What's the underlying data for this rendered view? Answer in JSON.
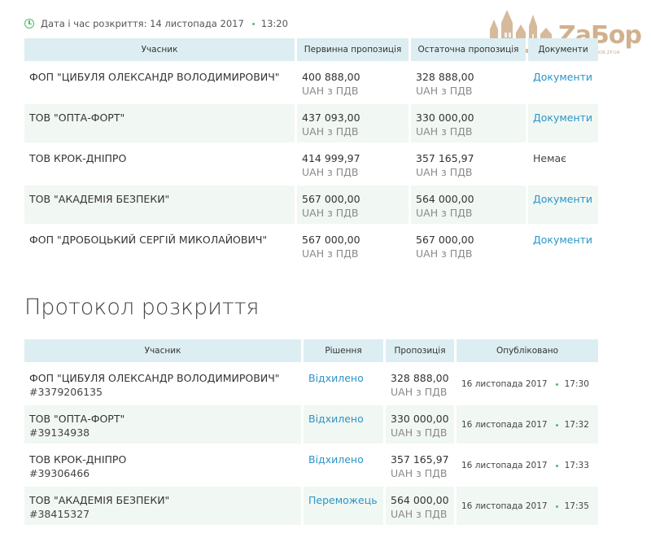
{
  "opening": {
    "label": "Дата і час розкриття: 14 листопада 2017",
    "time": "13:20"
  },
  "watermark": {
    "brand": "ZaБор",
    "url": "WWW.ZABOR.ZP.UA"
  },
  "bids_table": {
    "headers": [
      "Учасник",
      "Первинна пропозиція",
      "Остаточна пропозиція",
      "Документи"
    ],
    "rows": [
      {
        "participant": "ФОП \"ЦИБУЛЯ ОЛЕКСАНДР ВОЛОДИМИРОВИЧ\"",
        "initial": "400 888,00",
        "initial_vat": "UAH з ПДВ",
        "final": "328 888,00",
        "final_vat": "UAH з ПДВ",
        "docs": "Документи"
      },
      {
        "participant": "ТОВ \"ОПТА-ФОРТ\"",
        "initial": "437 093,00",
        "initial_vat": "UAH з ПДВ",
        "final": "330 000,00",
        "final_vat": "UAH з ПДВ",
        "docs": "Документи"
      },
      {
        "participant": "ТОВ КРОК-ДНІПРО",
        "initial": "414 999,97",
        "initial_vat": "UAH з ПДВ",
        "final": "357 165,97",
        "final_vat": "UAH з ПДВ",
        "docs": "Немає"
      },
      {
        "participant": "ТОВ \"АКАДЕМІЯ БЕЗПЕКИ\"",
        "initial": "567 000,00",
        "initial_vat": "UAH з ПДВ",
        "final": "564 000,00",
        "final_vat": "UAH з ПДВ",
        "docs": "Документи"
      },
      {
        "participant": "ФОП \"ДРОБОЦЬКИЙ СЕРГІЙ МИКОЛАЙОВИЧ\"",
        "initial": "567 000,00",
        "initial_vat": "UAH з ПДВ",
        "final": "567 000,00",
        "final_vat": "UAH з ПДВ",
        "docs": "Документи"
      }
    ]
  },
  "protocol": {
    "title": "Протокол розкриття",
    "headers": [
      "Учасник",
      "Рішення",
      "Пропозиція",
      "Опубліковано"
    ],
    "rows": [
      {
        "participant": "ФОП \"ЦИБУЛЯ ОЛЕКСАНДР ВОЛОДИМИРОВИЧ\"",
        "code": "#3379206135",
        "decision": "Відхилено",
        "amount": "328 888,00",
        "vat": "UAH з ПДВ",
        "date": "16 листопада 2017",
        "time": "17:30"
      },
      {
        "participant": "ТОВ \"ОПТА-ФОРТ\"",
        "code": "#39134938",
        "decision": "Відхилено",
        "amount": "330 000,00",
        "vat": "UAH з ПДВ",
        "date": "16 листопада 2017",
        "time": "17:32"
      },
      {
        "participant": "ТОВ КРОК-ДНІПРО",
        "code": "#39306466",
        "decision": "Відхилено",
        "amount": "357 165,97",
        "vat": "UAH з ПДВ",
        "date": "16 листопада 2017",
        "time": "17:33"
      },
      {
        "participant": "ТОВ \"АКАДЕМІЯ БЕЗПЕКИ\"",
        "code": "#38415327",
        "decision": "Переможець",
        "amount": "564 000,00",
        "vat": "UAH з ПДВ",
        "date": "16 листопада 2017",
        "time": "17:35"
      }
    ]
  },
  "colors": {
    "link": "#2a95c9",
    "accent_green": "#4cbb6c",
    "header_bg": "#ddeef2",
    "row_alt_bg": "#f1f7f2"
  }
}
